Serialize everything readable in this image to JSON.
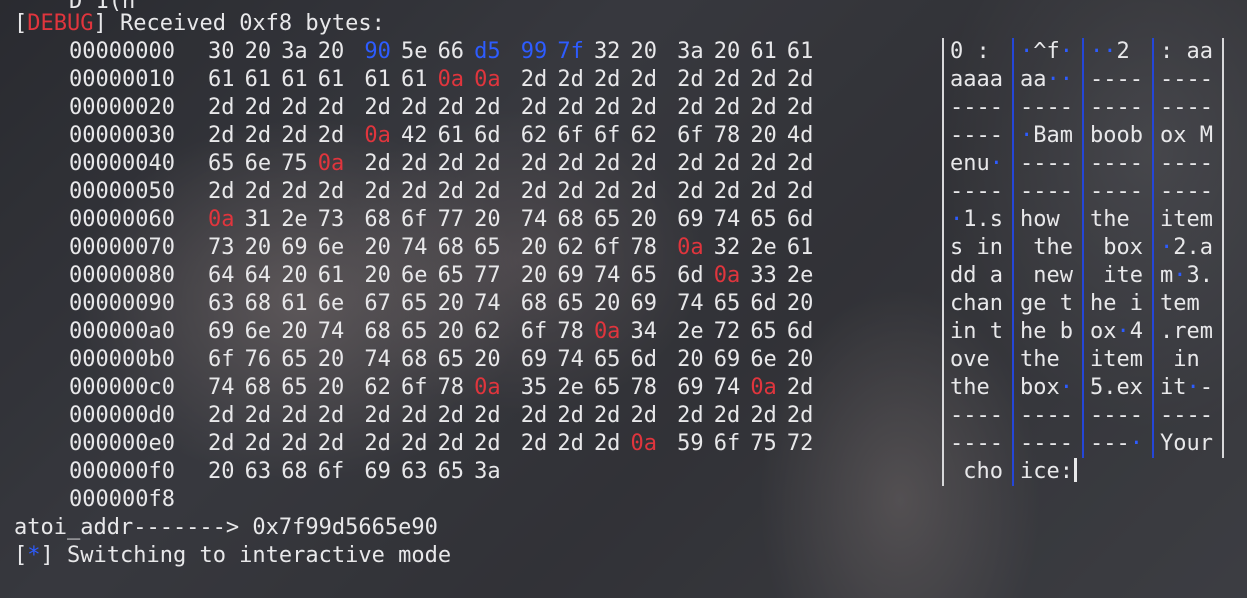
{
  "top_fragment": "D 1(n",
  "debug_tag": "DEBUG",
  "received_text": "Received 0xf8 bytes:",
  "offsets": [
    "00000000",
    "00000010",
    "00000020",
    "00000030",
    "00000040",
    "00000050",
    "00000060",
    "00000070",
    "00000080",
    "00000090",
    "000000a0",
    "000000b0",
    "000000c0",
    "000000d0",
    "000000e0",
    "000000f0",
    "000000f8"
  ],
  "hex_rows": [
    [
      "30",
      "20",
      "3a",
      "20",
      "90",
      "5e",
      "66",
      "d5",
      "99",
      "7f",
      "32",
      "20",
      "3a",
      "20",
      "61",
      "61"
    ],
    [
      "61",
      "61",
      "61",
      "61",
      "61",
      "61",
      "0a",
      "0a",
      "2d",
      "2d",
      "2d",
      "2d",
      "2d",
      "2d",
      "2d",
      "2d"
    ],
    [
      "2d",
      "2d",
      "2d",
      "2d",
      "2d",
      "2d",
      "2d",
      "2d",
      "2d",
      "2d",
      "2d",
      "2d",
      "2d",
      "2d",
      "2d",
      "2d"
    ],
    [
      "2d",
      "2d",
      "2d",
      "2d",
      "0a",
      "42",
      "61",
      "6d",
      "62",
      "6f",
      "6f",
      "62",
      "6f",
      "78",
      "20",
      "4d"
    ],
    [
      "65",
      "6e",
      "75",
      "0a",
      "2d",
      "2d",
      "2d",
      "2d",
      "2d",
      "2d",
      "2d",
      "2d",
      "2d",
      "2d",
      "2d",
      "2d"
    ],
    [
      "2d",
      "2d",
      "2d",
      "2d",
      "2d",
      "2d",
      "2d",
      "2d",
      "2d",
      "2d",
      "2d",
      "2d",
      "2d",
      "2d",
      "2d",
      "2d"
    ],
    [
      "0a",
      "31",
      "2e",
      "73",
      "68",
      "6f",
      "77",
      "20",
      "74",
      "68",
      "65",
      "20",
      "69",
      "74",
      "65",
      "6d"
    ],
    [
      "73",
      "20",
      "69",
      "6e",
      "20",
      "74",
      "68",
      "65",
      "20",
      "62",
      "6f",
      "78",
      "0a",
      "32",
      "2e",
      "61"
    ],
    [
      "64",
      "64",
      "20",
      "61",
      "20",
      "6e",
      "65",
      "77",
      "20",
      "69",
      "74",
      "65",
      "6d",
      "0a",
      "33",
      "2e"
    ],
    [
      "63",
      "68",
      "61",
      "6e",
      "67",
      "65",
      "20",
      "74",
      "68",
      "65",
      "20",
      "69",
      "74",
      "65",
      "6d",
      "20"
    ],
    [
      "69",
      "6e",
      "20",
      "74",
      "68",
      "65",
      "20",
      "62",
      "6f",
      "78",
      "0a",
      "34",
      "2e",
      "72",
      "65",
      "6d"
    ],
    [
      "6f",
      "76",
      "65",
      "20",
      "74",
      "68",
      "65",
      "20",
      "69",
      "74",
      "65",
      "6d",
      "20",
      "69",
      "6e",
      "20"
    ],
    [
      "74",
      "68",
      "65",
      "20",
      "62",
      "6f",
      "78",
      "0a",
      "35",
      "2e",
      "65",
      "78",
      "69",
      "74",
      "0a",
      "2d"
    ],
    [
      "2d",
      "2d",
      "2d",
      "2d",
      "2d",
      "2d",
      "2d",
      "2d",
      "2d",
      "2d",
      "2d",
      "2d",
      "2d",
      "2d",
      "2d",
      "2d"
    ],
    [
      "2d",
      "2d",
      "2d",
      "2d",
      "2d",
      "2d",
      "2d",
      "2d",
      "2d",
      "2d",
      "2d",
      "0a",
      "59",
      "6f",
      "75",
      "72"
    ],
    [
      "20",
      "63",
      "68",
      "6f",
      "69",
      "63",
      "65",
      "3a"
    ]
  ],
  "ascii_rows": [
    [
      "0 : ",
      "·^f·",
      "··2 ",
      ": aa"
    ],
    [
      "aaaa",
      "aa··",
      "----",
      "----"
    ],
    [
      "----",
      "----",
      "----",
      "----"
    ],
    [
      "----",
      "·Bam",
      "boob",
      "ox M"
    ],
    [
      "enu·",
      "----",
      "----",
      "----"
    ],
    [
      "----",
      "----",
      "----",
      "----"
    ],
    [
      "·1.s",
      "how ",
      "the ",
      "item"
    ],
    [
      "s in",
      " the",
      " box",
      "·2.a"
    ],
    [
      "dd a",
      " new",
      " ite",
      "m·3."
    ],
    [
      "chan",
      "ge t",
      "he i",
      "tem "
    ],
    [
      "in t",
      "he b",
      "ox·4",
      ".rem"
    ],
    [
      "ove ",
      "the ",
      "item",
      " in "
    ],
    [
      "the ",
      "box·",
      "5.ex",
      "it·-"
    ],
    [
      "----",
      "----",
      "----",
      "----"
    ],
    [
      "----",
      "----",
      "---·",
      "Your"
    ],
    [
      " cho",
      "ice:"
    ]
  ],
  "atoi_line": "atoi_addr-------> 0x7f99d5665e90",
  "star_tag": "*",
  "interactive_text": "Switching to interactive mode",
  "colors": {
    "red": "#e0353d",
    "blue": "#2d5cff",
    "text": "#e8e8ea"
  },
  "highlight": {
    "blue_cells": [
      [
        0,
        4
      ],
      [
        0,
        7
      ],
      [
        0,
        8
      ],
      [
        0,
        9
      ]
    ],
    "red_cells": [
      [
        1,
        6
      ],
      [
        1,
        7
      ],
      [
        3,
        4
      ],
      [
        4,
        3
      ],
      [
        6,
        0
      ],
      [
        7,
        12
      ],
      [
        8,
        13
      ],
      [
        10,
        10
      ],
      [
        12,
        7
      ],
      [
        12,
        14
      ],
      [
        14,
        11
      ]
    ]
  }
}
